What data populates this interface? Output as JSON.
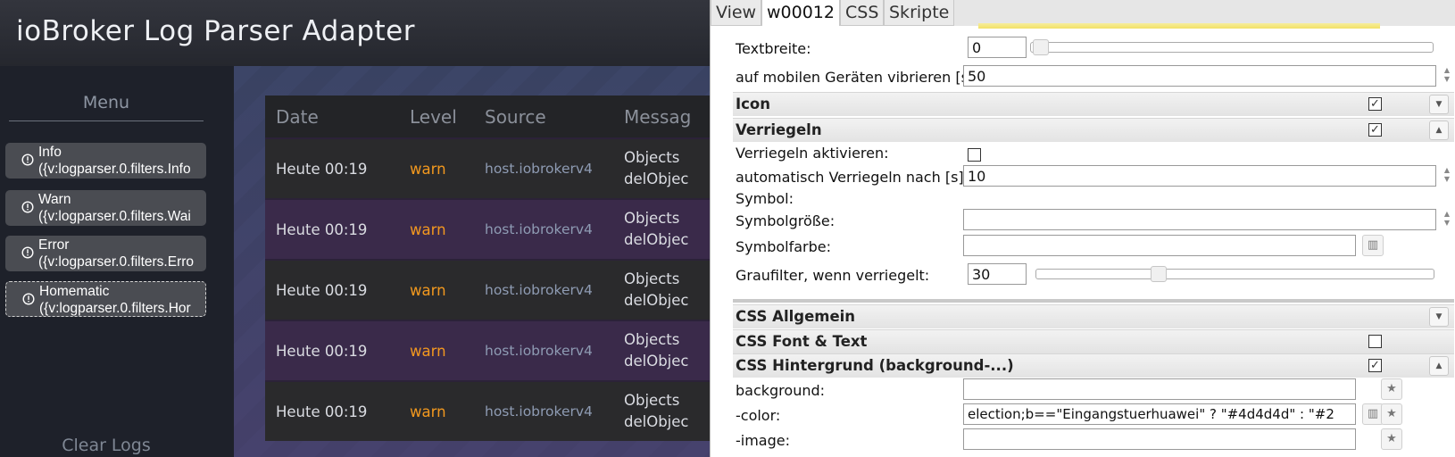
{
  "app": {
    "title": "ioBroker Log Parser Adapter"
  },
  "sidebar": {
    "menu_title": "Menu",
    "items": [
      {
        "line1": "Info",
        "line2": "({v:logparser.0.filters.Info"
      },
      {
        "line1": "Warn",
        "line2": "({v:logparser.0.filters.Wai"
      },
      {
        "line1": "Error",
        "line2": "({v:logparser.0.filters.Erro"
      },
      {
        "line1": "Homematic",
        "line2": "({v:logparser.0.filters.Hor"
      }
    ],
    "clear_logs": "Clear Logs"
  },
  "log_table": {
    "columns": [
      "Date",
      "Level",
      "Source",
      "Messag"
    ],
    "rows": [
      {
        "date": "Heute 00:19",
        "level": "warn",
        "source": "host.iobrokerv4",
        "msg1": "Objects",
        "msg2": "delObjec"
      },
      {
        "date": "Heute 00:19",
        "level": "warn",
        "source": "host.iobrokerv4",
        "msg1": "Objects",
        "msg2": "delObjec"
      },
      {
        "date": "Heute 00:19",
        "level": "warn",
        "source": "host.iobrokerv4",
        "msg1": "Objects",
        "msg2": "delObjec"
      },
      {
        "date": "Heute 00:19",
        "level": "warn",
        "source": "host.iobrokerv4",
        "msg1": "Objects",
        "msg2": "delObjec"
      },
      {
        "date": "Heute 00:19",
        "level": "warn",
        "source": "host.iobrokerv4",
        "msg1": "Objects",
        "msg2": "delObjec"
      }
    ]
  },
  "editor": {
    "tabs": [
      "View",
      "w00012",
      "CSS",
      "Skripte"
    ],
    "active_tab": "w00012",
    "props": {
      "textbreite": {
        "label": "Textbreite:",
        "value": "0"
      },
      "vibrieren": {
        "label": "auf mobilen Geräten vibrieren [s]:",
        "value": "50"
      },
      "icon_group": {
        "label": "Icon",
        "checked": true
      },
      "verriegeln_group": {
        "label": "Verriegeln",
        "checked": true
      },
      "verriegeln_aktivieren": {
        "label": "Verriegeln aktivieren:",
        "checked": false
      },
      "auto_verriegeln": {
        "label": "automatisch Verriegeln nach [s]:",
        "value": "10"
      },
      "symbol": {
        "label": "Symbol:"
      },
      "symbolgroesse": {
        "label": "Symbolgröße:",
        "value": ""
      },
      "symbolfarbe": {
        "label": "Symbolfarbe:",
        "value": ""
      },
      "graufilter": {
        "label": "Graufilter, wenn verriegelt:",
        "value": "30",
        "level_percent": 30
      },
      "css_allgemein": {
        "label": "CSS Allgemein"
      },
      "css_font": {
        "label": "CSS Font & Text",
        "checked": false
      },
      "css_hintergrund": {
        "label": "CSS Hintergrund (background-...)",
        "checked": true
      },
      "background": {
        "label": "background:",
        "value": ""
      },
      "color": {
        "label": "-color:",
        "value": "election;b==\"Eingangstuerhuawei\" ? \"#4d4d4d\" : \"#2"
      },
      "image": {
        "label": "-image:",
        "value": ""
      }
    }
  },
  "colors": {
    "warn": "#f2981f",
    "accent_bg": "#1e212a"
  }
}
